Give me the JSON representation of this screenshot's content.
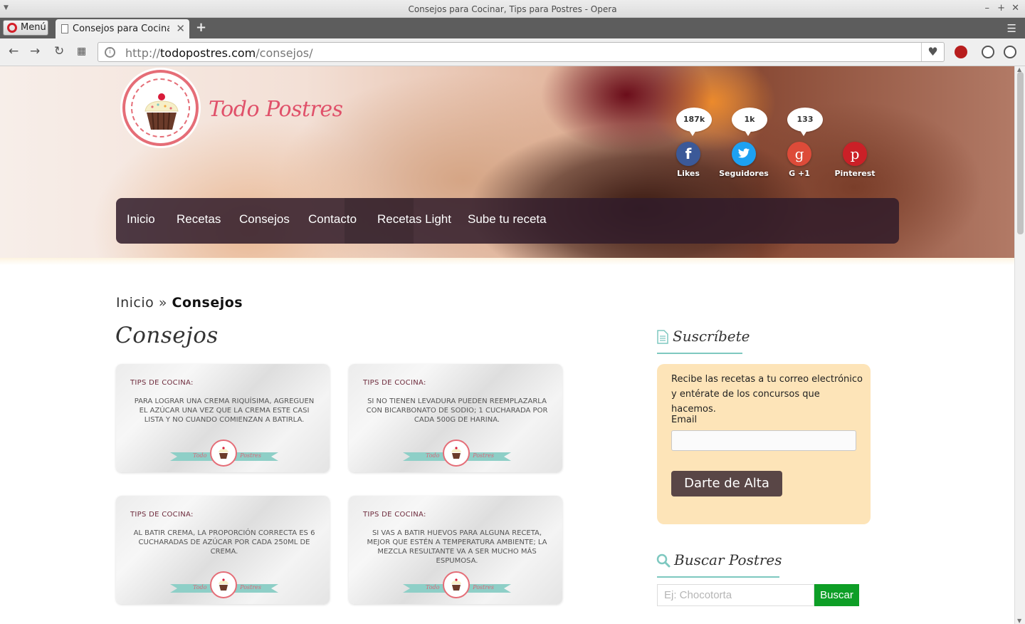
{
  "window": {
    "title": "Consejos para Cocinar, Tips para Postres - Opera"
  },
  "tabs": {
    "menu_label": "Menú",
    "active_tab": "Consejos para Cocinar, Tips para Postres",
    "new_tab": "+"
  },
  "address": {
    "scheme": "http://",
    "host": "todopostres.com",
    "path": "/consejos/"
  },
  "site": {
    "logo_text": "Todo Postres",
    "social": [
      {
        "count": "187k",
        "label": "Likes",
        "icon": "facebook-icon",
        "color": "#3b5998",
        "glyph": "f"
      },
      {
        "count": "1k",
        "label": "Seguidores",
        "icon": "twitter-icon",
        "color": "#1da1f2",
        "glyph": "t"
      },
      {
        "count": "133",
        "label": "G +1",
        "icon": "google-plus-icon",
        "color": "#dd4b39",
        "glyph": "g"
      },
      {
        "count": "",
        "label": "Pinterest",
        "icon": "pinterest-icon",
        "color": "#cb2027",
        "glyph": "p"
      }
    ],
    "nav": [
      "Inicio",
      "Recetas",
      "Consejos",
      "Contacto",
      "Recetas Light",
      "Sube tu receta"
    ],
    "nav_active": "Consejos"
  },
  "breadcrumb": {
    "home": "Inicio",
    "sep": "»",
    "current": "Consejos"
  },
  "page_title": "Consejos",
  "cards": [
    {
      "title": "TIPS DE COCINA:",
      "text": "Para lograr una crema riquísima, agreguen el azúcar una vez que la crema este casi lista y no cuando comienzan a batirla.",
      "brand_left": "Todo",
      "brand_right": "Postres"
    },
    {
      "title": "TIPS DE COCINA:",
      "text": "Si no tienen levadura pueden reemplazarla con bicarbonato de sodio; 1 cucharada por cada 500g de harina.",
      "brand_left": "Todo",
      "brand_right": "Postres"
    },
    {
      "title": "TIPS DE COCINA:",
      "text": "Al batir crema, la proporción correcta es 6 cucharadas de azúcar por cada 250ml de crema.",
      "brand_left": "Todo",
      "brand_right": "Postres"
    },
    {
      "title": "TIPS DE COCINA:",
      "text": "Si vas a batir huevos para alguna receta, mejor que estén a temperatura ambiente; la mezcla resultante va a ser mucho más espumosa.",
      "brand_left": "Todo",
      "brand_right": "Postres"
    }
  ],
  "sidebar": {
    "subscribe": {
      "title": "Suscríbete",
      "intro": "Recibe las recetas a tu correo electrónico y entérate de los concursos que hacemos.",
      "email_label": "Email",
      "email_value": "",
      "button": "Darte de Alta"
    },
    "search": {
      "title": "Buscar Postres",
      "placeholder": "Ej: Chocotorta",
      "button": "Buscar"
    }
  },
  "colors": {
    "nav_bg": "#311c2a",
    "accent_pink": "#e0516a",
    "widget_line": "#7ec8c0",
    "subscribe_bg": "#fde4b8",
    "search_button": "#0d9e26"
  }
}
